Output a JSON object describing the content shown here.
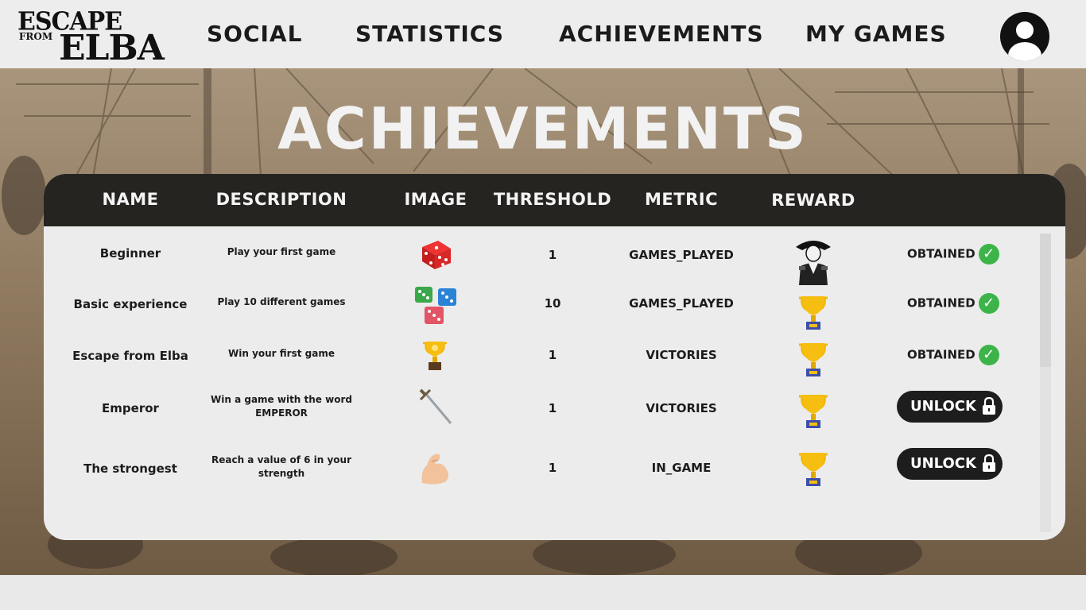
{
  "logo": {
    "line1": "ESCAPE",
    "line2a": "FROM",
    "line3": "ELBA"
  },
  "nav": {
    "social": "SOCIAL",
    "statistics": "STATISTICS",
    "achievements": "ACHIEVEMENTS",
    "my_games": "MY GAMES"
  },
  "page_title": "ACHIEVEMENTS",
  "table": {
    "headers": {
      "name": "NAME",
      "description": "DESCRIPTION",
      "image": "IMAGE",
      "threshold": "THRESHOLD",
      "metric": "METRIC",
      "reward": "REWARD"
    },
    "rows": [
      {
        "name": "Beginner",
        "description": "Play your first game",
        "image": "red-die-icon",
        "threshold": "1",
        "metric": "GAMES_PLAYED",
        "reward": "napoleon-portrait",
        "status": "OBTAINED"
      },
      {
        "name": "Basic experience",
        "description": "Play 10 different games",
        "image": "three-dice-icon",
        "threshold": "10",
        "metric": "GAMES_PLAYED",
        "reward": "trophy-icon",
        "status": "OBTAINED"
      },
      {
        "name": "Escape from Elba",
        "description": "Win your first game",
        "image": "trophy-icon",
        "threshold": "1",
        "metric": "VICTORIES",
        "reward": "trophy-icon",
        "status": "OBTAINED"
      },
      {
        "name": "Emperor",
        "description": "Win a game with the word EMPEROR",
        "image": "sword-icon",
        "threshold": "1",
        "metric": "VICTORIES",
        "reward": "trophy-icon",
        "status": "UNLOCK"
      },
      {
        "name": "The strongest",
        "description": "Reach a value of 6 in your strength",
        "image": "flexed-arm-icon",
        "threshold": "1",
        "metric": "IN_GAME",
        "reward": "trophy-icon",
        "status": "UNLOCK"
      }
    ]
  },
  "colors": {
    "header_bg": "#262421",
    "check": "#3cb449",
    "unlock_bg": "#1d1d1d"
  }
}
